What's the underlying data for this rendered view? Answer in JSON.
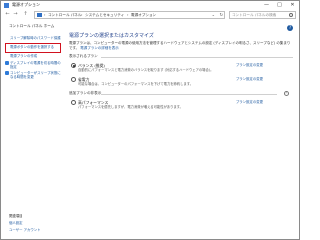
{
  "window": {
    "title": "電源オプション",
    "minimize": "—",
    "maximize": "□",
    "close": "✕"
  },
  "address": {
    "back": "←",
    "forward": "→",
    "up": "↑",
    "crumbs": [
      "›",
      "コントロール パネル",
      "›",
      "システムとセキュリティ",
      "›",
      "電源オプション"
    ],
    "dropdown": "⌄",
    "refresh": "↻",
    "search_placeholder": "コントロール パネルの検索"
  },
  "sidebar": {
    "home": "コントロール パネル ホーム",
    "items": [
      {
        "label": "スリープ解除時のパスワード保護",
        "shield": false
      },
      {
        "label": "電源ボタンの動作を選択する",
        "shield": false,
        "highlighted": true
      },
      {
        "label": "電源プランの作成",
        "shield": false
      },
      {
        "label": "ディスプレイの電源を切る時間の指定",
        "shield": true
      },
      {
        "label": "コンピューターがスリープ状態になる時間を変更",
        "shield": true
      }
    ],
    "see_also": "関連項目",
    "bottom_links": [
      "個人設定",
      "ユーザー アカウント"
    ]
  },
  "main": {
    "help": "?",
    "heading": "電源プランの選択またはカスタマイズ",
    "description": "電源プランは、コンピューターの電源の使用方法を管理するハードウェアとシステムの設定 (ディスプレイの明るさ、スリープなど) の集まりです。",
    "description_link": "電源プランの詳細を表示",
    "primary_section": "表示されるプラン",
    "plans": [
      {
        "name": "バランス (推奨)",
        "selected": true,
        "desc": "自動的にパフォーマンスと電力消費のバランスを取ります (対応するハードウェアの場合)。",
        "link": "プラン設定の変更"
      },
      {
        "name": "省電力",
        "selected": false,
        "desc": "可能な場合は、コンピューターのパフォーマンスを下げて電力を節約します。",
        "link": "プラン設定の変更"
      }
    ],
    "hidden_section": "追加プランの非表示",
    "hidden_expand": "⌃",
    "hidden_plans": [
      {
        "name": "高パフォーマンス",
        "selected": false,
        "desc": "パフォーマンスを優先しますが、電力消費が増える可能性があります。",
        "link": "プラン設定の変更"
      }
    ]
  }
}
